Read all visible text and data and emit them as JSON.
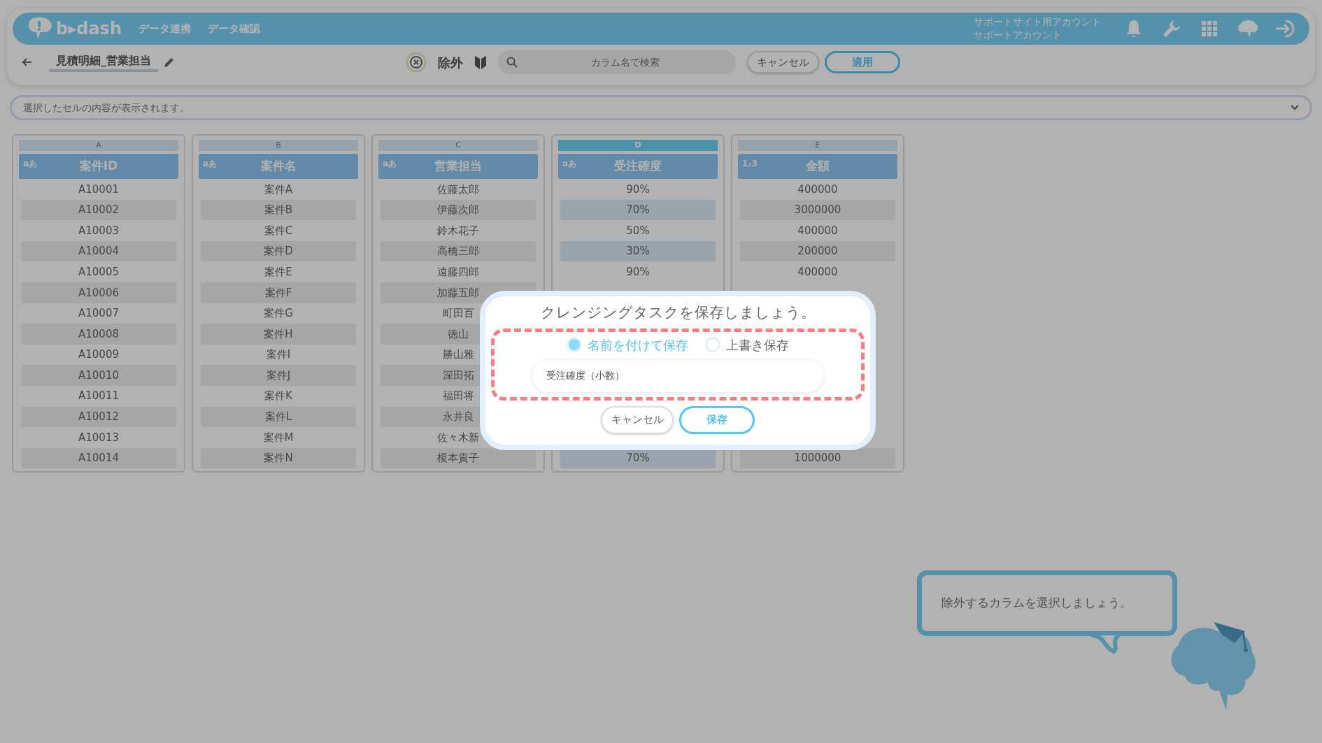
{
  "header": {
    "logo": "b▸dash",
    "nav": [
      {
        "label": "データ連携"
      },
      {
        "label": "データ確認"
      }
    ],
    "account": [
      "サポートサイト用アカウント",
      "サポートアカウント"
    ]
  },
  "toolbar": {
    "title": "見積明細_営業担当",
    "exclude_label": "除外",
    "search": {
      "placeholder": "カラム名で検索"
    },
    "buttons": [
      {
        "label": "キャンセル",
        "kind": "secondary"
      },
      {
        "label": "適用",
        "kind": "primary"
      }
    ]
  },
  "cell_preview": {
    "placeholder": "選択したセルの内容が表示されます。"
  },
  "columns": [
    {
      "letter": "A",
      "type_label": "aあ",
      "name": "案件ID",
      "selected": false,
      "values": [
        "A10001",
        "A10002",
        "A10003",
        "A10004",
        "A10005",
        "A10006",
        "A10007",
        "A10008",
        "A10009",
        "A10010",
        "A10011",
        "A10012",
        "A10013",
        "A10014"
      ]
    },
    {
      "letter": "B",
      "type_label": "aあ",
      "name": "案件名",
      "selected": false,
      "values": [
        "案件A",
        "案件B",
        "案件C",
        "案件D",
        "案件E",
        "案件F",
        "案件G",
        "案件H",
        "案件I",
        "案件J",
        "案件K",
        "案件L",
        "案件M",
        "案件N"
      ]
    },
    {
      "letter": "C",
      "type_label": "aあ",
      "name": "営業担当",
      "selected": false,
      "values": [
        "佐藤太郎",
        "伊藤次郎",
        "鈴木花子",
        "高橋三郎",
        "遠藤四郎",
        "加藤五郎",
        "町田百",
        "徳山",
        "勝山雅",
        "深田拓",
        "福田将",
        "永井良",
        "佐々木新",
        "榎本貴子"
      ]
    },
    {
      "letter": "D",
      "type_label": "aあ",
      "name": "受注確度",
      "selected": true,
      "values": [
        "90%",
        "70%",
        "50%",
        "30%",
        "90%"
      ],
      "values_below_dialog": [
        "70%"
      ]
    },
    {
      "letter": "E",
      "type_label": "1₂3",
      "name": "金額",
      "selected": false,
      "values": [
        "400000",
        "3000000",
        "400000",
        "200000",
        "400000"
      ],
      "values_below_dialog": [
        "1000000"
      ]
    }
  ],
  "dialog": {
    "title": "クレンジングタスクを保存しましょう。",
    "options": [
      {
        "label": "名前を付けて保存",
        "selected": true
      },
      {
        "label": "上書き保存",
        "selected": false
      }
    ],
    "name_field": {
      "value": "受注確度（小数）"
    },
    "buttons": [
      {
        "label": "キャンセル",
        "kind": "secondary"
      },
      {
        "label": "保存",
        "kind": "primary"
      }
    ]
  },
  "tip": {
    "text": "除外するカラムを選択しましょう。"
  }
}
